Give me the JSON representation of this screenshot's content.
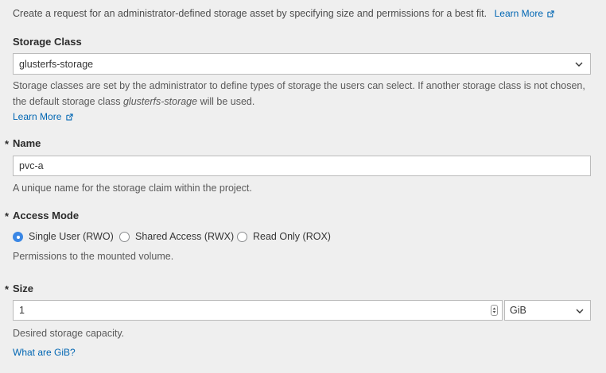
{
  "intro": {
    "text": "Create a request for an administrator-defined storage asset by specifying size and permissions for a best fit.",
    "learn_more": "Learn More"
  },
  "storage_class": {
    "label": "Storage Class",
    "value": "glusterfs-storage",
    "help_part1": "Storage classes are set by the administrator to define types of storage the users can select. If another storage class is not chosen,",
    "help_part2": "the default storage class ",
    "help_emph": "glusterfs-storage",
    "help_part3": " will be used.",
    "learn_more": "Learn More"
  },
  "name": {
    "required_mark": "*",
    "label": "Name",
    "value": "pvc-a",
    "help": "A unique name for the storage claim within the project."
  },
  "access_mode": {
    "required_mark": "*",
    "label": "Access Mode",
    "options": [
      {
        "label": "Single User (RWO)",
        "selected": true
      },
      {
        "label": "Shared Access (RWX)",
        "selected": false
      },
      {
        "label": "Read Only (ROX)",
        "selected": false
      }
    ],
    "help": "Permissions to the mounted volume."
  },
  "size": {
    "required_mark": "*",
    "label": "Size",
    "value": "1",
    "unit": "GiB",
    "help": "Desired storage capacity.",
    "link": "What are GiB?"
  },
  "colors": {
    "accent": "#3a87e5",
    "link": "#0066b3",
    "background": "#efefef"
  },
  "icons": [
    "external-link-icon",
    "chevron-down-icon",
    "spinner-arrows-icon"
  ]
}
